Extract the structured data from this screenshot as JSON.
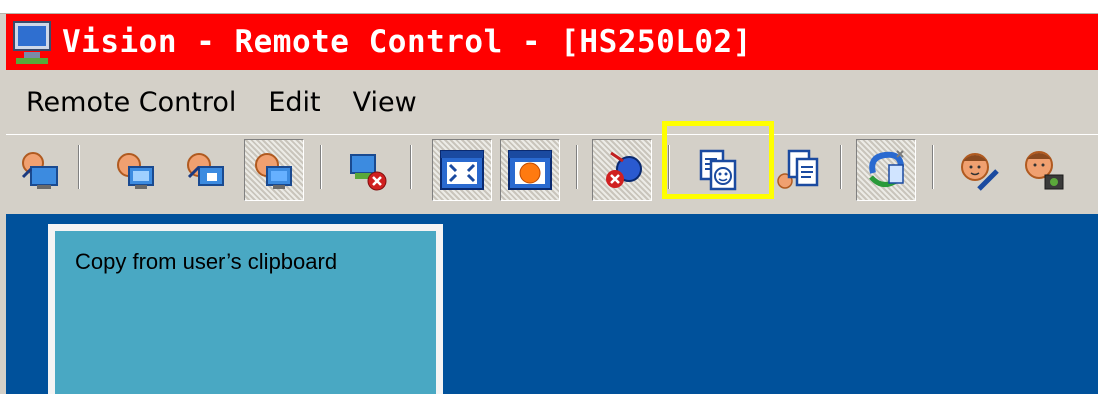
{
  "window": {
    "title": "Vision - Remote Control - [HS250L02]",
    "icon": "monitor-icon"
  },
  "menu": {
    "items": [
      "Remote Control",
      "Edit",
      "View"
    ]
  },
  "toolbar": {
    "buttons": [
      {
        "icon": "connect-user-icon"
      },
      {
        "icon": "view-mode-icon"
      },
      {
        "icon": "share-mode-icon"
      },
      {
        "icon": "control-mode-icon",
        "pressed": true
      },
      {
        "icon": "disconnect-icon"
      },
      {
        "icon": "fullscreen-icon",
        "pressed": true
      },
      {
        "icon": "record-icon",
        "pressed": true
      },
      {
        "icon": "blank-screen-icon",
        "pressed": true
      },
      {
        "icon": "copy-from-clipboard-icon",
        "highlighted": true
      },
      {
        "icon": "copy-to-clipboard-icon"
      },
      {
        "icon": "file-transfer-icon",
        "pressed": true
      },
      {
        "icon": "annotate-icon"
      },
      {
        "icon": "snapshot-icon"
      }
    ]
  },
  "colors": {
    "titlebar": "#ff0000",
    "workspace": "#00519b",
    "tooltip": "#49a8c3",
    "highlight": "#ffff00"
  },
  "tooltip": {
    "text": "Copy from user’s clipboard"
  }
}
